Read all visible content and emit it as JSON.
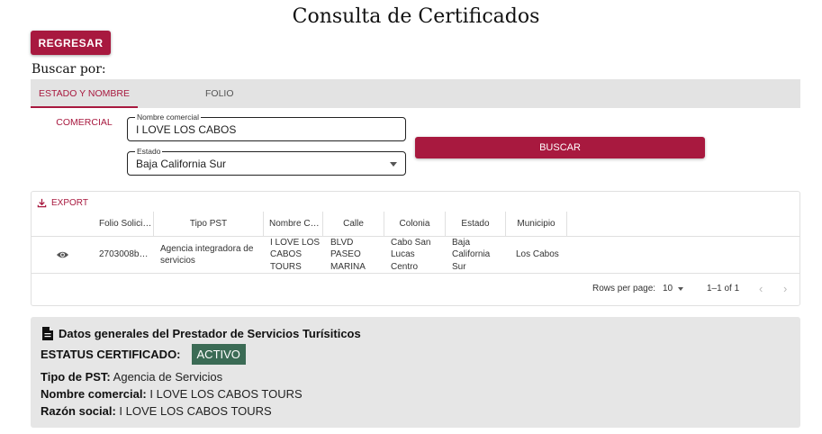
{
  "page": {
    "title": "Consulta de Certificados"
  },
  "back_button": {
    "label": "REGRESAR"
  },
  "search": {
    "heading": "Buscar por:",
    "tabs": [
      {
        "label": "ESTADO Y NOMBRE COMERCIAL",
        "active": true
      },
      {
        "label": "FOLIO",
        "active": false
      }
    ],
    "nombre_comercial": {
      "label": "Nombre comercial",
      "value": "I LOVE LOS CABOS"
    },
    "estado": {
      "label": "Estado",
      "value": "Baja California Sur"
    },
    "submit_label": "BUSCAR"
  },
  "results": {
    "export_label": "EXPORT",
    "columns": [
      "Folio Solici…",
      "Tipo PST",
      "Nombre C…",
      "Calle",
      "Colonia",
      "Estado",
      "Municipio"
    ],
    "rows": [
      {
        "folio": "2703008b…",
        "tipo_pst": "Agencia integradora de servicios",
        "nombre": "I LOVE LOS CABOS TOURS",
        "calle": "BLVD PASEO MARINA",
        "colonia": "Cabo San Lucas Centro",
        "estado": "Baja California Sur",
        "municipio": "Los Cabos"
      }
    ],
    "rows_per_page_label": "Rows per page:",
    "rows_per_page_value": "10",
    "range": "1–1 of 1"
  },
  "details": {
    "title": "Datos generales del Prestador de Servicios Turísiticos",
    "status_label": "ESTATUS CERTIFICADO:",
    "status_value": "ACTIVO",
    "tipo_pst_label": "Tipo de PST:",
    "tipo_pst_value": "Agencia de Servicios",
    "nombre_label": "Nombre comercial:",
    "nombre_value": "I LOVE LOS CABOS TOURS",
    "razon_label": "Razón social:",
    "razon_value": "I LOVE LOS CABOS TOURS"
  },
  "colors": {
    "brand": "#a8193f",
    "status": "#3b6b55"
  },
  "icons": [
    "download-icon",
    "eye-icon",
    "chevron-left-icon",
    "chevron-right-icon",
    "document-icon",
    "dropdown-caret-icon"
  ]
}
